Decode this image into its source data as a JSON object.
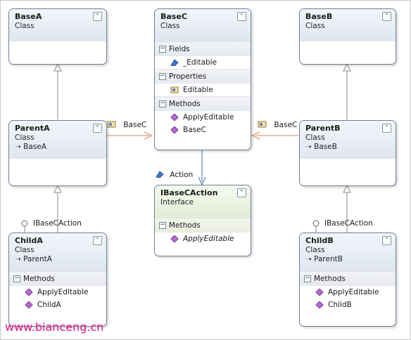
{
  "classes": {
    "baseA": {
      "name": "BaseA",
      "stereotype": "Class"
    },
    "baseC": {
      "name": "BaseC",
      "stereotype": "Class",
      "fields_label": "Fields",
      "field1": "_Editable",
      "properties_label": "Properties",
      "prop1": "Editable",
      "methods_label": "Methods",
      "method1": "ApplyEditable",
      "method2": "BaseC"
    },
    "baseB": {
      "name": "BaseB",
      "stereotype": "Class"
    },
    "parentA": {
      "name": "ParentA",
      "stereotype": "Class",
      "base": "BaseA"
    },
    "parentB": {
      "name": "ParentB",
      "stereotype": "Class",
      "base": "BaseB"
    },
    "iBaseCAction": {
      "name": "IBaseCAction",
      "stereotype": "Interface",
      "methods_label": "Methods",
      "method1": "ApplyEditable"
    },
    "childA": {
      "name": "ChildA",
      "stereotype": "Class",
      "base": "ParentA",
      "methods_label": "Methods",
      "method1": "ApplyEditable",
      "method2": "ChildA"
    },
    "childB": {
      "name": "ChildB",
      "stereotype": "Class",
      "base": "ParentB",
      "methods_label": "Methods",
      "method1": "ApplyEditable",
      "method2": "ChildB"
    }
  },
  "associations": {
    "left_label": "BaseC",
    "right_label": "BaseC",
    "action_label": "Action",
    "lollipop_left": "IBaseCAction",
    "lollipop_right": "IBaseCAction"
  },
  "colors": {
    "association": "#d2875a",
    "dependency": "#3b6fb5",
    "inheritance": "#8a8a8a",
    "watermark": "#e0188a"
  },
  "watermark": "www.bianceng.cn"
}
